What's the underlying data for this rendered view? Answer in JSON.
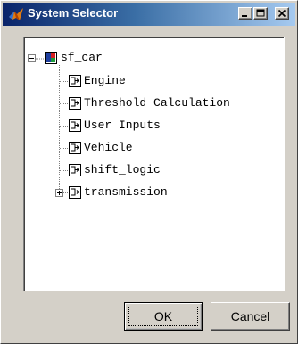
{
  "window": {
    "title": "System Selector",
    "app_icon": "matlab-logo-icon",
    "controls": [
      "minimize-icon",
      "maximize-icon",
      "close-icon"
    ]
  },
  "tree": {
    "root": {
      "label": "sf_car",
      "icon": "model-icon",
      "expanded": true
    },
    "children": [
      {
        "label": "Engine",
        "icon": "subsystem-icon",
        "expandable": false
      },
      {
        "label": "Threshold Calculation",
        "icon": "subsystem-icon",
        "expandable": false
      },
      {
        "label": "User Inputs",
        "icon": "subsystem-icon",
        "expandable": false
      },
      {
        "label": "Vehicle",
        "icon": "subsystem-icon",
        "expandable": false
      },
      {
        "label": "shift_logic",
        "icon": "subsystem-icon",
        "expandable": false
      },
      {
        "label": "transmission",
        "icon": "subsystem-icon",
        "expandable": true,
        "expanded": false
      }
    ]
  },
  "buttons": {
    "ok_label": "OK",
    "cancel_label": "Cancel"
  }
}
